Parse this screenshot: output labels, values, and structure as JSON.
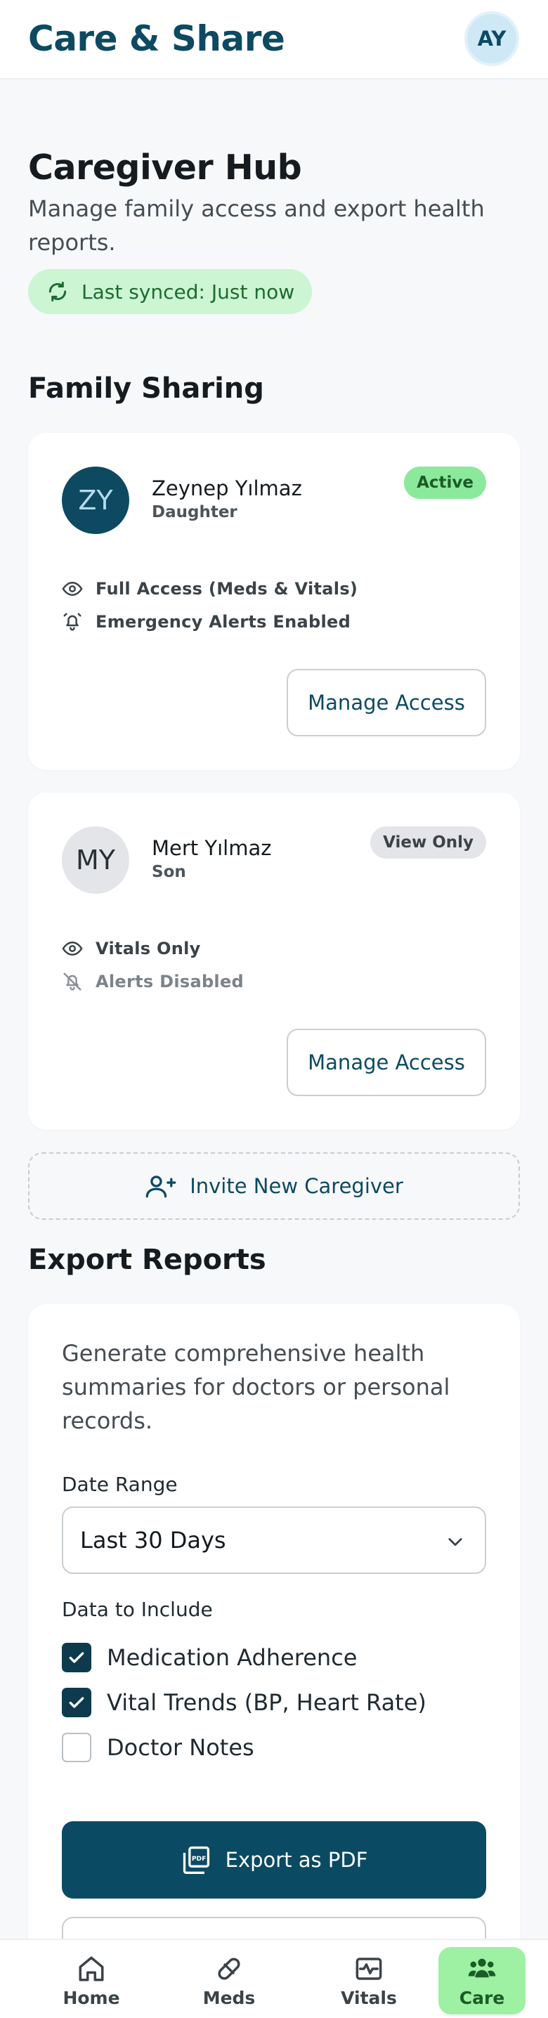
{
  "app": {
    "title": "Care & Share",
    "user_initials": "AY"
  },
  "page": {
    "title": "Caregiver Hub",
    "subtitle": "Manage family access and export health reports.",
    "sync_status": "Last synced: Just now"
  },
  "family_sharing": {
    "title": "Family Sharing",
    "caregivers": [
      {
        "initials": "ZY",
        "name": "Zeynep Yılmaz",
        "role": "Daughter",
        "status": "Active",
        "access": "Full Access (Meds & Vitals)",
        "alerts": "Emergency Alerts Enabled",
        "manage_label": "Manage Access"
      },
      {
        "initials": "MY",
        "name": "Mert Yılmaz",
        "role": "Son",
        "status": "View Only",
        "access": "Vitals Only",
        "alerts": "Alerts Disabled",
        "manage_label": "Manage Access"
      }
    ],
    "invite_label": "Invite New Caregiver"
  },
  "export": {
    "title": "Export Reports",
    "description": "Generate comprehensive health summaries for doctors or personal records.",
    "date_range_label": "Date Range",
    "date_range_value": "Last 30 Days",
    "include_label": "Data to Include",
    "options": [
      {
        "label": "Medication Adherence",
        "checked": true
      },
      {
        "label": "Vital Trends (BP, Heart Rate)",
        "checked": true
      },
      {
        "label": "Doctor Notes",
        "checked": false
      }
    ],
    "pdf_label": "Export as PDF"
  },
  "nav": {
    "items": [
      {
        "label": "Home",
        "icon": "home-icon"
      },
      {
        "label": "Meds",
        "icon": "pill-icon"
      },
      {
        "label": "Vitals",
        "icon": "vitals-icon"
      },
      {
        "label": "Care",
        "icon": "people-icon",
        "active": true
      }
    ]
  },
  "colors": {
    "brand": "#0d4a62",
    "active_badge": "#8be99b",
    "view_only_badge": "#e3e5e8",
    "sync_chip": "#ccf5d3",
    "nav_active": "#9ef0a2"
  }
}
